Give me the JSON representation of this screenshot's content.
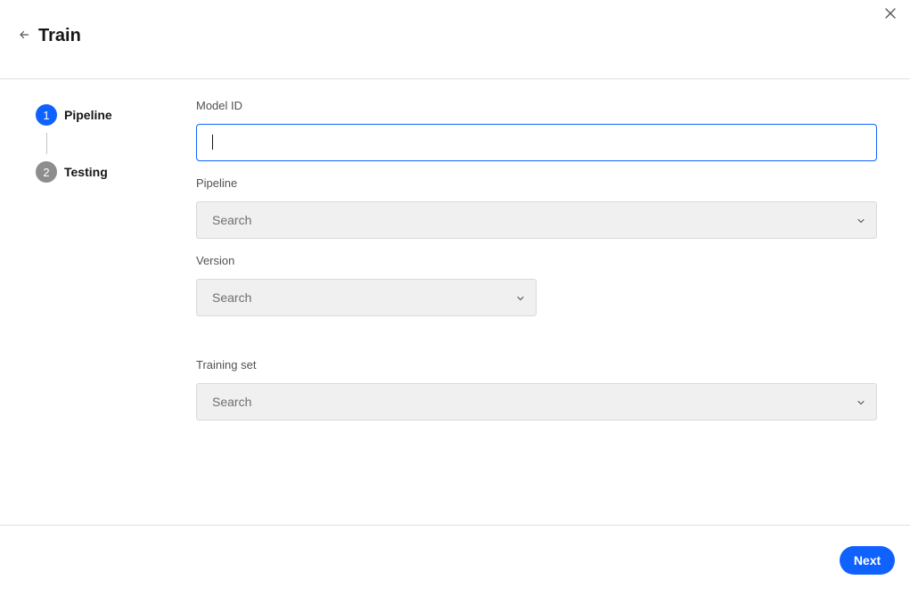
{
  "header": {
    "title": "Train",
    "back_icon": "arrow-left-icon",
    "close_icon": "close-icon"
  },
  "stepper": {
    "steps": [
      {
        "number": "1",
        "label": "Pipeline",
        "state": "active"
      },
      {
        "number": "2",
        "label": "Testing",
        "state": "inactive"
      }
    ]
  },
  "form": {
    "model_id": {
      "label": "Model ID",
      "value": "",
      "placeholder": ""
    },
    "pipeline": {
      "label": "Pipeline",
      "placeholder": "Search"
    },
    "version": {
      "label": "Version",
      "placeholder": "Search"
    },
    "training_set": {
      "label": "Training set",
      "placeholder": "Search"
    }
  },
  "footer": {
    "next_label": "Next"
  },
  "colors": {
    "accent": "#0f62fe",
    "inactive_step": "#8d8d8d",
    "select_bg": "#f0f0f0",
    "label": "#525252"
  }
}
